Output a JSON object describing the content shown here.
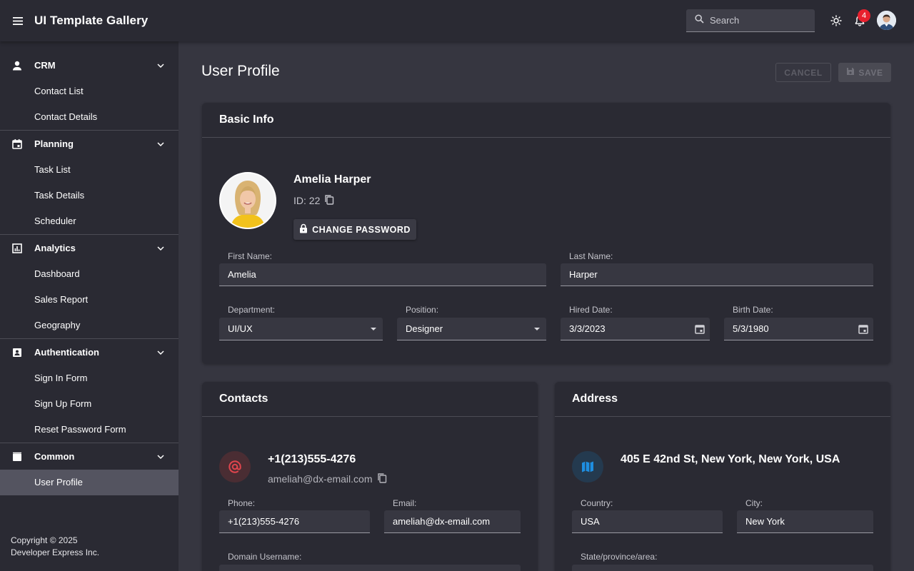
{
  "header": {
    "app_title": "UI Template Gallery",
    "search_placeholder": "Search",
    "notification_count": "4"
  },
  "sidebar": {
    "groups": [
      {
        "label": "CRM",
        "icon": "person-icon",
        "items": [
          "Contact List",
          "Contact Details"
        ]
      },
      {
        "label": "Planning",
        "icon": "calendar-icon",
        "items": [
          "Task List",
          "Task Details",
          "Scheduler"
        ]
      },
      {
        "label": "Analytics",
        "icon": "chart-icon",
        "items": [
          "Dashboard",
          "Sales Report",
          "Geography"
        ]
      },
      {
        "label": "Authentication",
        "icon": "id-badge-icon",
        "items": [
          "Sign In Form",
          "Sign Up Form",
          "Reset Password Form"
        ]
      },
      {
        "label": "Common",
        "icon": "folder-icon",
        "items": [
          "User Profile"
        ]
      }
    ],
    "active_item": "User Profile",
    "copyright_line1": "Copyright © 2025",
    "copyright_line2": "Developer Express Inc."
  },
  "page": {
    "title": "User Profile",
    "cancel_label": "CANCEL",
    "save_label": "SAVE"
  },
  "basic_info": {
    "title": "Basic Info",
    "name": "Amelia Harper",
    "id_text": "ID: 22",
    "change_password_label": "CHANGE PASSWORD",
    "first_name_label": "First Name:",
    "first_name": "Amelia",
    "last_name_label": "Last Name:",
    "last_name": "Harper",
    "department_label": "Department:",
    "department": "UI/UX",
    "position_label": "Position:",
    "position": "Designer",
    "hired_label": "Hired Date:",
    "hired": "3/3/2023",
    "birth_label": "Birth Date:",
    "birth": "5/3/1980"
  },
  "contacts": {
    "title": "Contacts",
    "phone_display": "+1(213)555-4276",
    "email_display": "ameliah@dx-email.com",
    "phone_label": "Phone:",
    "phone": "+1(213)555-4276",
    "email_label": "Email:",
    "email": "ameliah@dx-email.com",
    "domain_label": "Domain Username:"
  },
  "address": {
    "title": "Address",
    "full": "405 E 42nd St, New York, New York, USA",
    "country_label": "Country:",
    "country": "USA",
    "city_label": "City:",
    "city": "New York",
    "state_label": "State/province/area:"
  },
  "colors": {
    "accent_blue": "#1e8ee0",
    "accent_red": "#e0454d",
    "badge_red": "#e8202e"
  }
}
